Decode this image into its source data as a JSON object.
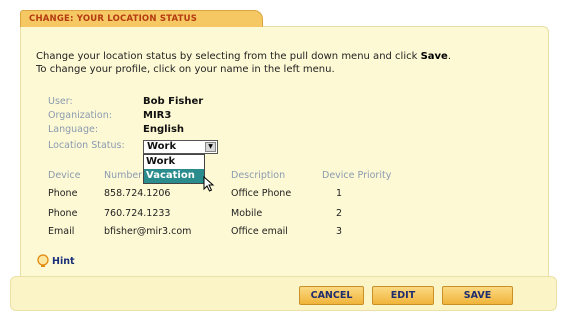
{
  "panel": {
    "tab_title": "CHANGE: YOUR LOCATION STATUS",
    "intro_line1_prefix": "Change your location status by selecting from the pull down menu and click ",
    "intro_line1_bold": "Save",
    "intro_line1_suffix": ".",
    "intro_line2": "To change your profile, click on your name in the left menu."
  },
  "profile": {
    "user_label": "User:",
    "user_value": "Bob Fisher",
    "org_label": "Organization:",
    "org_value": "MIR3",
    "language_label": "Language:",
    "language_value": "English",
    "location_label": "Location Status:"
  },
  "location_select": {
    "selected": "Work",
    "options": [
      "Work",
      "Vacation"
    ],
    "highlighted": "Vacation"
  },
  "devices": {
    "headers": [
      "Device",
      "Number",
      "Description",
      "Device Priority"
    ],
    "rows": [
      [
        "Phone",
        "858.724.1206",
        "Office Phone",
        "1"
      ],
      [
        "Phone",
        "760.724.1233",
        "Mobile",
        "2"
      ],
      [
        "Email",
        "bfisher@mir3.com",
        "Office email",
        "3"
      ]
    ]
  },
  "hint_label": "Hint",
  "buttons": {
    "cancel": "CANCEL",
    "edit": "EDIT",
    "save": "SAVE"
  },
  "colors": {
    "tab_bg": "#f6c864",
    "tab_text": "#b43a10",
    "panel_bg": "#fdf9d4",
    "label_color": "#8a9bb0",
    "highlight": "#2a8c8c",
    "button_text": "#1e2d6e"
  }
}
